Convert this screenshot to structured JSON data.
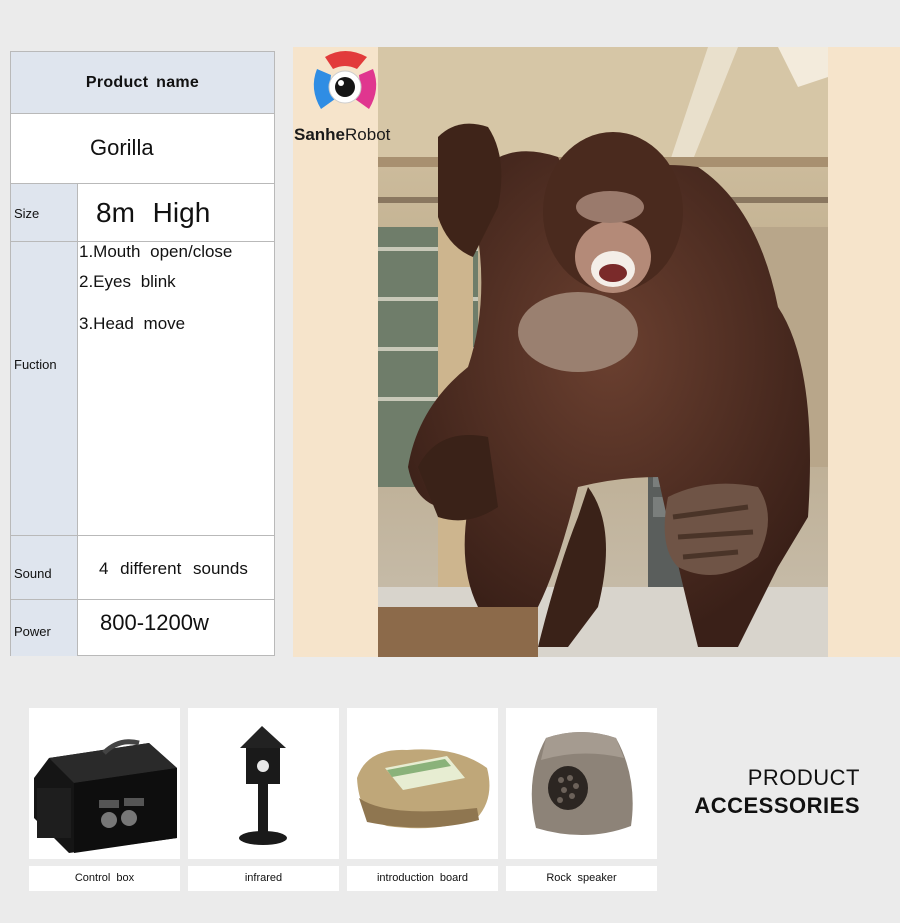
{
  "spec": {
    "header": "Product name",
    "product_name": "Gorilla",
    "size_label": "Size",
    "size_value": "8m High",
    "function_label": "Fuction",
    "functions": [
      "1.Mouth open/close",
      "2.Eyes blink",
      "3.Head move"
    ],
    "sound_label": "Sound",
    "sound_value": "4 different sounds",
    "power_label": "Power",
    "power_value": "800-1200w"
  },
  "logo": {
    "brand_bold": "Sanhe",
    "brand_light": "Robot"
  },
  "accessories": {
    "title_line1": "PRODUCT",
    "title_line2": "ACCESSORIES",
    "items": [
      {
        "label": "Control box",
        "icon": "control-box-image"
      },
      {
        "label": "infrared",
        "icon": "infrared-sensor-image"
      },
      {
        "label": "introduction board",
        "icon": "introduction-board-image"
      },
      {
        "label": "Rock speaker",
        "icon": "rock-speaker-image"
      }
    ]
  },
  "colors": {
    "table_label_bg": "#dfe5ee",
    "table_border": "#b9b9b9",
    "page_bg": "#ebebeb",
    "logo_red": "#e23b3b",
    "logo_blue": "#2f8de4",
    "logo_magenta": "#e0368f"
  }
}
